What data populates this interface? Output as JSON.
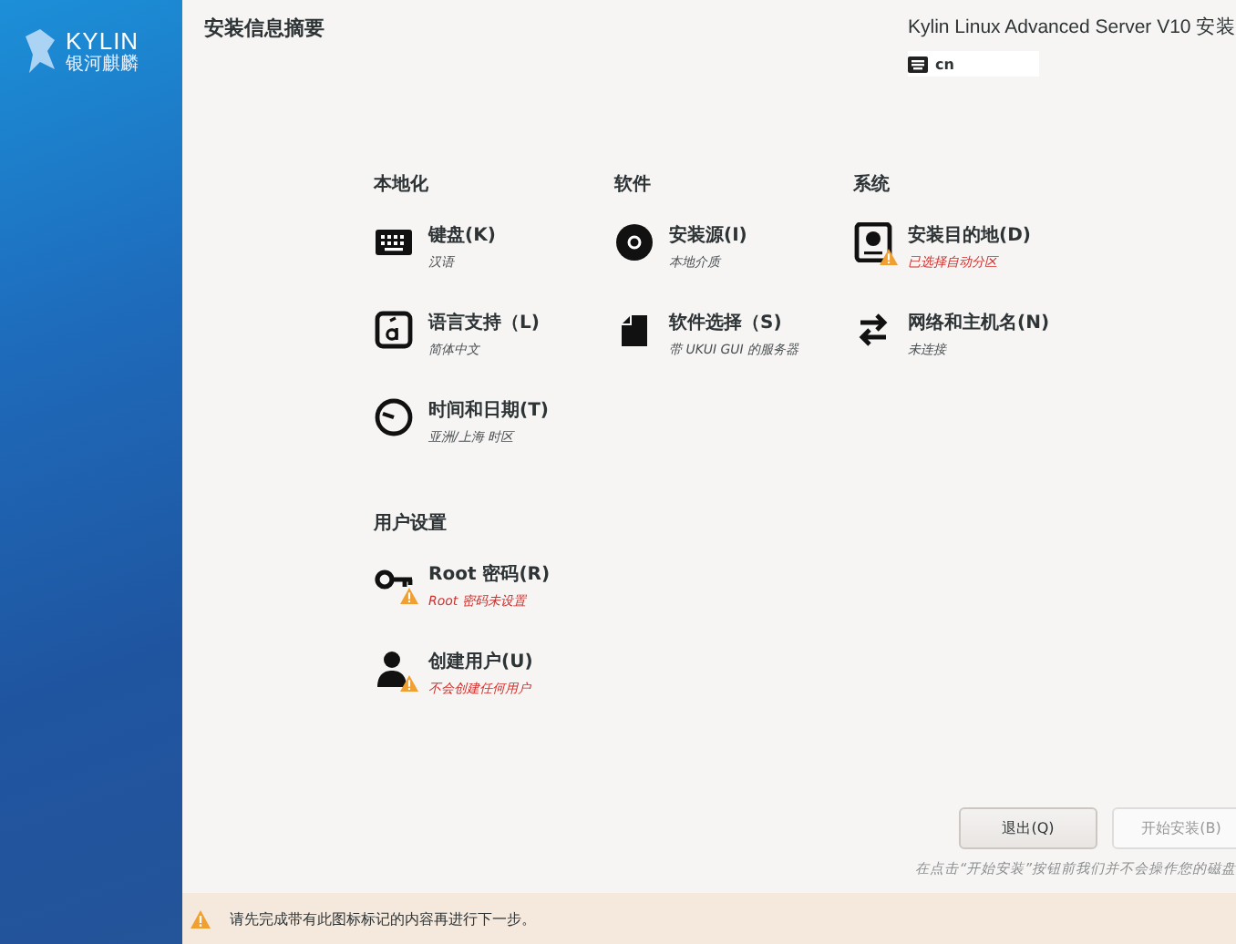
{
  "sidebar": {
    "logo_text": "KYLIN",
    "logo_subtext": "银河麒麟"
  },
  "header": {
    "title": "安装信息摘要",
    "product": "Kylin Linux Advanced Server V10 安装",
    "keyboard_layout": "cn"
  },
  "sections": [
    {
      "heading": "本地化",
      "items": [
        {
          "kind": "keyboard",
          "title": "键盘(K)",
          "status": "汉语",
          "warning": false
        },
        {
          "kind": "language",
          "title": "语言支持（L)",
          "status": "简体中文",
          "warning": false
        },
        {
          "kind": "clock",
          "title": "时间和日期(T)",
          "status": "亚洲/上海 时区",
          "warning": false
        }
      ]
    },
    {
      "heading": "软件",
      "items": [
        {
          "kind": "disc",
          "title": "安装源(I)",
          "status": "本地介质",
          "warning": false
        },
        {
          "kind": "package",
          "title": "软件选择（S)",
          "status": "带 UKUI GUI 的服务器",
          "warning": false
        }
      ]
    },
    {
      "heading": "系统",
      "items": [
        {
          "kind": "disk",
          "title": "安装目的地(D)",
          "status": "已选择自动分区",
          "warning": true
        },
        {
          "kind": "network",
          "title": "网络和主机名(N)",
          "status": "未连接",
          "warning": false
        }
      ]
    },
    {
      "heading": "用户设置",
      "items": [
        {
          "kind": "key",
          "title": "Root 密码(R)",
          "status": "Root 密码未设置",
          "warning": true
        },
        {
          "kind": "user",
          "title": "创建用户(U)",
          "status": "不会创建任何用户",
          "warning": true
        }
      ]
    }
  ],
  "buttons": [
    {
      "label": "退出(Q)",
      "disabled": false
    },
    {
      "label": "开始安装(B)",
      "disabled": true
    }
  ],
  "note": "在点击“开始安装”按钮前我们并不会操作您的磁盘",
  "warning_bar": {
    "message": "请先完成带有此图标标记的内容再进行下一步。"
  }
}
